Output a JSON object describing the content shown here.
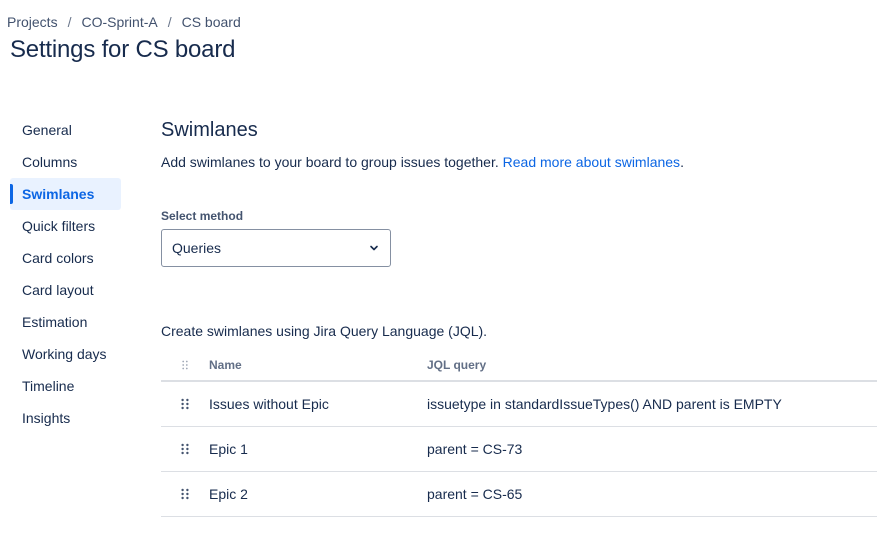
{
  "breadcrumb": {
    "items": [
      "Projects",
      "CO-Sprint-A",
      "CS board"
    ],
    "separator": "/"
  },
  "page_title": "Settings for CS board",
  "sidebar": {
    "items": [
      {
        "label": "General",
        "active": false
      },
      {
        "label": "Columns",
        "active": false
      },
      {
        "label": "Swimlanes",
        "active": true
      },
      {
        "label": "Quick filters",
        "active": false
      },
      {
        "label": "Card colors",
        "active": false
      },
      {
        "label": "Card layout",
        "active": false
      },
      {
        "label": "Estimation",
        "active": false
      },
      {
        "label": "Working days",
        "active": false
      },
      {
        "label": "Timeline",
        "active": false
      },
      {
        "label": "Insights",
        "active": false
      }
    ]
  },
  "main": {
    "section_title": "Swimlanes",
    "description": "Add swimlanes to your board to group issues together.",
    "read_more_link": "Read more about swimlanes",
    "description_end": ".",
    "select_method": {
      "label": "Select method",
      "value": "Queries",
      "icon": "chevron-down-icon"
    },
    "jql_intro": "Create swimlanes using Jira Query Language (JQL).",
    "table": {
      "columns": [
        "Name",
        "JQL query"
      ],
      "rows": [
        {
          "name": "Issues without Epic",
          "jql": "issuetype in standardIssueTypes() AND parent is EMPTY"
        },
        {
          "name": "Epic 1",
          "jql": "parent = CS-73"
        },
        {
          "name": "Epic 2",
          "jql": "parent = CS-65"
        }
      ]
    }
  },
  "colors": {
    "text": "#172B4D",
    "link": "#0C66E4",
    "active_bg": "#E9F2FF",
    "border": "#DCDFE4"
  }
}
